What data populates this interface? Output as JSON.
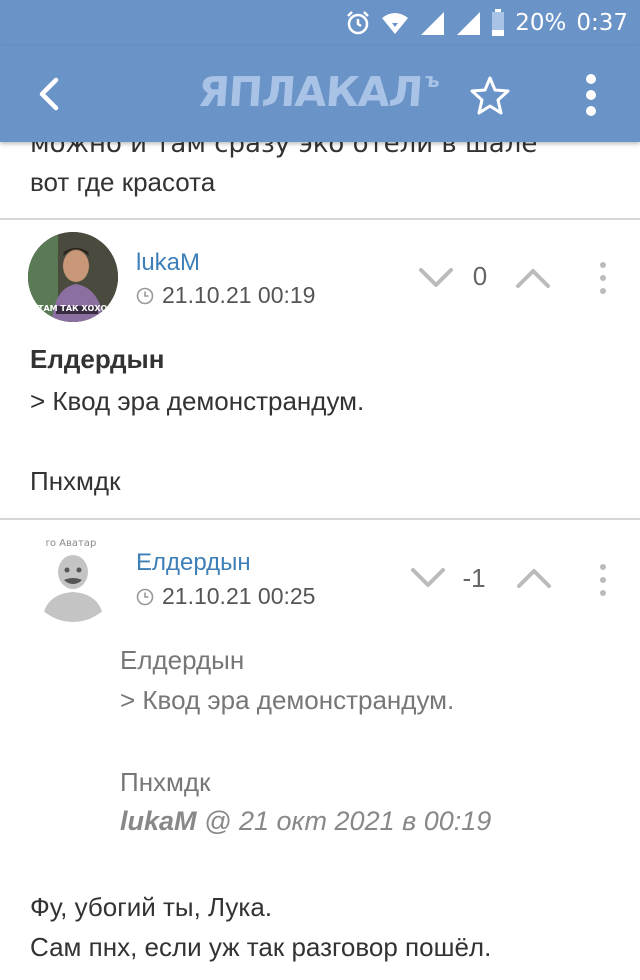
{
  "status_bar": {
    "battery": "20%",
    "time": "0:37"
  },
  "app_bar": {
    "logo_text": "ЯПЛАКАЛ",
    "logo_suffix": "ъ"
  },
  "previous_comment": {
    "text": "вот где красота",
    "cut_text": "можно и там сразу эко отели в шале"
  },
  "comments": [
    {
      "username": "lukaM",
      "datetime": "21.10.21 00:19",
      "vote_count": "0",
      "avatar_caption": "ТАМ ТАК ХОХО",
      "quote_author": "Елдердын",
      "quote_line": "> Квод эра демонстрандум.",
      "reply": "Пнхмдк"
    },
    {
      "username": "Елдердын",
      "datetime": "21.10.21 00:25",
      "vote_count": "-1",
      "avatar_caption": "то Аватар",
      "quote_author": "Елдердын",
      "quote_line": "> Квод эра демонстрандум.",
      "quote_reply": "Пнхмдк",
      "quote_sign_user": "lukaM",
      "quote_sign_rest": " @ 21 окт 2021 в 00:19",
      "line1": "Фу, убогий ты, Лука.",
      "line2": "Сам пнх, если уж так разговор пошёл."
    }
  ]
}
